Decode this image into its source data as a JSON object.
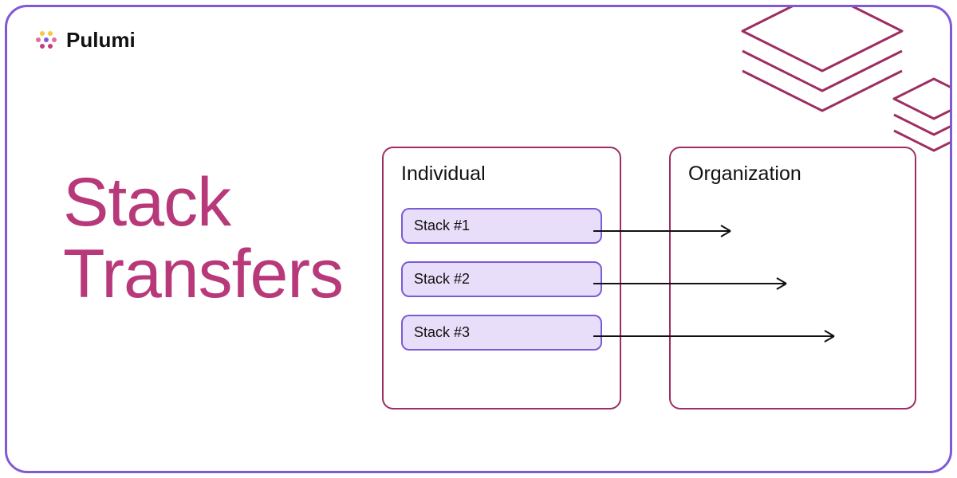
{
  "brand": {
    "name": "Pulumi"
  },
  "hero": {
    "title_line1": "Stack",
    "title_line2": "Transfers"
  },
  "diagram": {
    "source_label": "Individual",
    "target_label": "Organization",
    "stacks": [
      {
        "label": "Stack #1"
      },
      {
        "label": "Stack #2"
      },
      {
        "label": "Stack #3"
      }
    ]
  },
  "colors": {
    "card_border": "#805ad5",
    "heading": "#b8397a",
    "box_border": "#9e2e62",
    "stack_border": "#7a5bd7",
    "stack_fill": "#e9def9"
  }
}
